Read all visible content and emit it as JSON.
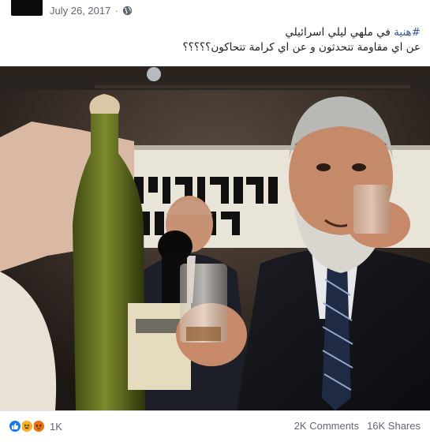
{
  "post": {
    "date": "July 26, 2017",
    "separator": "·",
    "privacy_icon": "globe-icon",
    "text": {
      "hashtag": "#هنية",
      "line1_rest": " في ملهي ليلي اسرائيلي",
      "line2": "عن اي مقاومة تتحدثون و عن اي كرامة تتحاكون؟؟؟؟؟"
    },
    "photo_alt": "photo"
  },
  "footer": {
    "reaction_icons": [
      "like-icon",
      "haha-icon",
      "angry-icon"
    ],
    "reaction_count": "1K",
    "comments": "2K Comments",
    "shares": "16K Shares"
  },
  "colors": {
    "hashtag": "#385898",
    "like": "#1877f2",
    "haha": "#f7b125",
    "angry": "#e9710f",
    "meta": "#616770"
  }
}
